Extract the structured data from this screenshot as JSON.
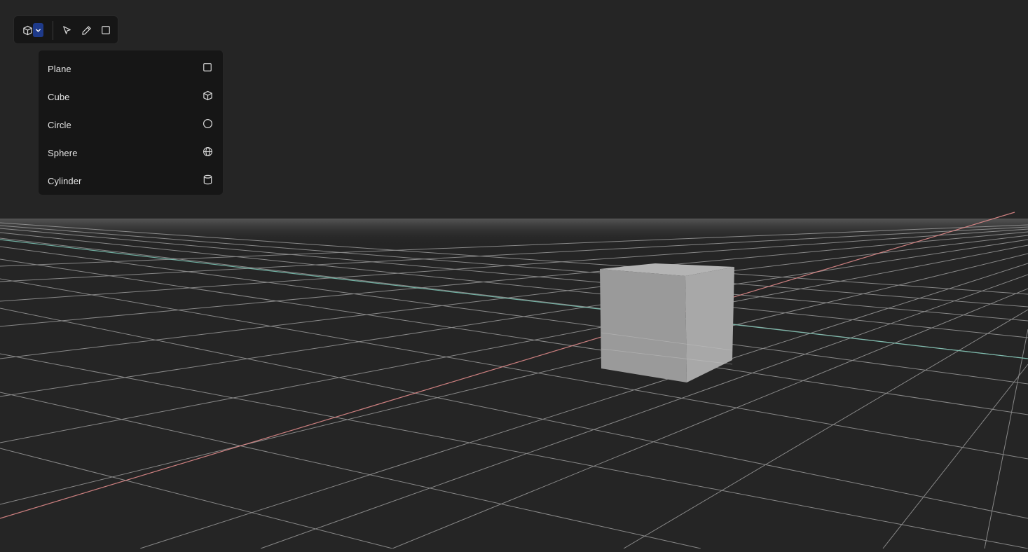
{
  "toolbar": {
    "shape_tool_icon": "cube-icon",
    "dropdown_icon": "chevron-down-icon",
    "tools": [
      {
        "name": "select-tool",
        "icon": "cursor-arrow-icon"
      },
      {
        "name": "pen-tool",
        "icon": "pencil-icon"
      },
      {
        "name": "rectangle-tool",
        "icon": "square-icon"
      }
    ],
    "accent_color": "#1e3a8a"
  },
  "shape_menu": {
    "items": [
      {
        "label": "Plane",
        "icon": "square-icon"
      },
      {
        "label": "Cube",
        "icon": "cube-icon"
      },
      {
        "label": "Circle",
        "icon": "circle-icon"
      },
      {
        "label": "Sphere",
        "icon": "globe-icon"
      },
      {
        "label": "Cylinder",
        "icon": "cylinder-icon"
      }
    ]
  },
  "scene": {
    "background_color": "#252525",
    "grid_color": "#9a9a9a",
    "x_axis_color": "#e08a8a",
    "z_axis_color": "#7fc9b8",
    "objects": [
      {
        "type": "cube",
        "color": "#9c9c9c"
      }
    ]
  }
}
